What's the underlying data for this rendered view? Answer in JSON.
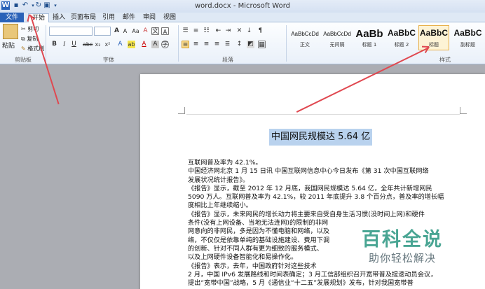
{
  "window": {
    "title": "word.docx - Microsoft Word"
  },
  "tabs": [
    "文件",
    "开始",
    "插入",
    "页面布局",
    "引用",
    "邮件",
    "审阅",
    "视图"
  ],
  "clipboard": {
    "paste_label": "粘贴",
    "cut_label": "剪切",
    "copy_label": "复制",
    "format_painter_label": "格式刷",
    "group_label": "剪贴板"
  },
  "font_group": {
    "label": "字体"
  },
  "paragraph_group": {
    "label": "段落"
  },
  "styles": {
    "group_label": "样式",
    "items": [
      {
        "sample": "AaBbCcDd",
        "name": "正文"
      },
      {
        "sample": "AaBbCcDd",
        "name": "无间隔"
      },
      {
        "sample": "AaBb",
        "name": "标题 1"
      },
      {
        "sample": "AaBbC",
        "name": "标题 2"
      },
      {
        "sample": "AaBbC",
        "name": "标题"
      },
      {
        "sample": "AaBbC",
        "name": "副标题"
      }
    ]
  },
  "document": {
    "title": "中国网民规模达 5.64 亿",
    "lines": [
      "互联网普及率为 42.1%。",
      "中国经济网北京 1 月 15 日讯  中国互联网信息中心今日发布《第 31 次中国互联网络",
      "发展状况统计报告》。",
      "《报告》显示，截至 2012 年 12 月底，我国网民规模达 5.64 亿，全年共计新增网民",
      "5090 万人。互联网普及率为 42.1%，较 2011 年底提升 3.8 个百分点，普及率的增长幅",
      "度相比上年继续缩小。",
      "《报告》显示，未来网民的增长动力将主要来自受自身生活习惯(没时间上网)和硬件",
      "条件(没有上网设备、当地无法连网)的限制的非网",
      "网意向的非网民，多是因为不懂电脑和网络，以及",
      "络，不仅仅是依靠单纯的基础设施建设、费用下调",
      "的创新、针对不同人群有更为细致的服务模式、",
      "以及上网硬件设备智能化和易操作化。",
      "《报告》表示，去年，中国政府针对这些技术",
      "2 月，中国 IPv6 发展路线和时间表确定；3 月工信部组织召开宽带普及提速动员会议，",
      "提出“宽带中国”战略，5 月《通信业“十二五”发展规划》发布，针对我国宽带普"
    ]
  },
  "watermark": {
    "title": "百科全说",
    "subtitle": "助你轻松解决"
  },
  "colors": {
    "accent": "#2a62b8",
    "arrow": "#e04850",
    "selection": "#b9d2ee"
  }
}
